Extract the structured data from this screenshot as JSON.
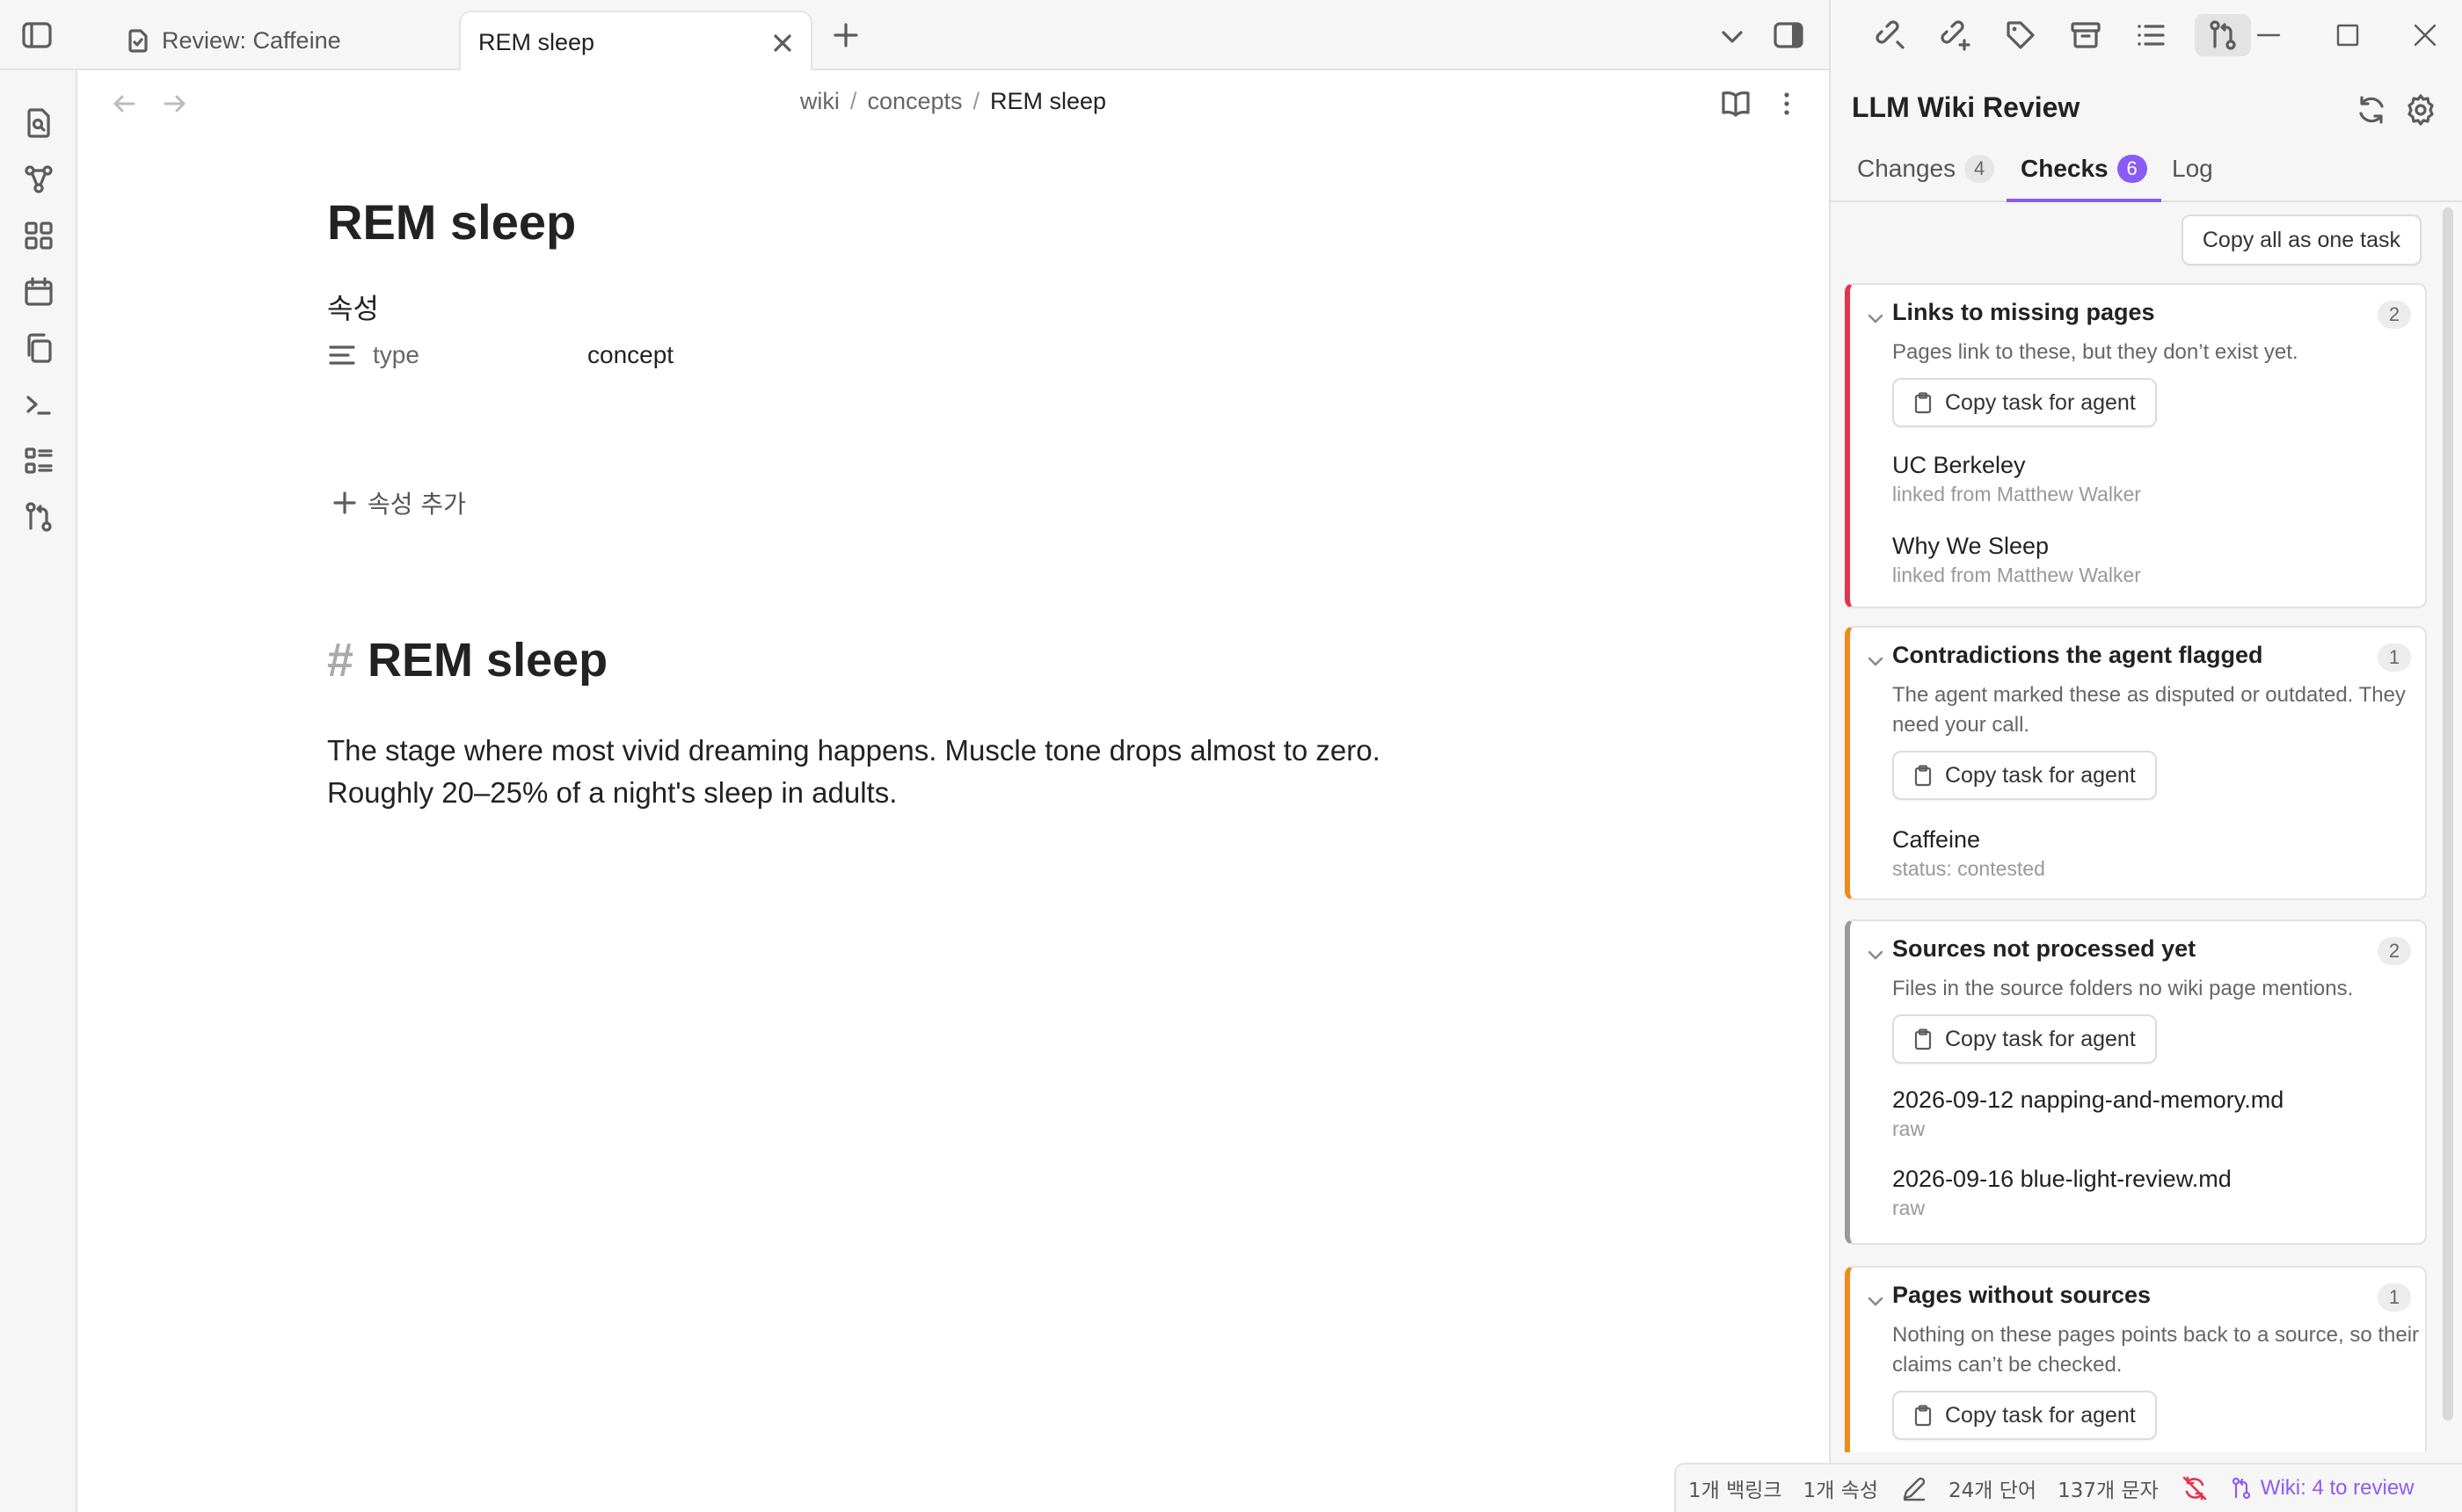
{
  "colors": {
    "accent": "#8a5cf5",
    "missing_pages_border": "#e5334b",
    "contradictions_border": "#f08a1c",
    "sources_border": "#9a9a9a",
    "pages_without_sources_border": "#f08a1c",
    "sync_error": "#e5334b"
  },
  "tabs": [
    {
      "label": "Review: Caffeine",
      "icon": "file-icon",
      "active": false
    },
    {
      "label": "REM sleep",
      "active": true
    }
  ],
  "ribbon": {
    "icons": [
      "search-file-icon",
      "graph-icon",
      "canvas-icon",
      "calendar-icon",
      "copy-icon",
      "terminal-icon",
      "outline-icon",
      "git-compare-icon"
    ]
  },
  "editor": {
    "breadcrumb": [
      "wiki",
      "concepts",
      "REM sleep"
    ],
    "title": "REM sleep",
    "properties_heading": "속성",
    "properties": [
      {
        "key": "type",
        "value": "concept"
      }
    ],
    "add_property_label": "속성 추가",
    "heading_hash": "#",
    "heading": "REM sleep",
    "body": "The stage where most vivid dreaming happens. Muscle tone drops almost to zero. Roughly 20–25% of a night's sleep in adults."
  },
  "panel": {
    "toolbar_icons": [
      "link-off-icon",
      "link-add-icon",
      "tag-icon",
      "archive-icon",
      "list-icon",
      "git-compare-icon"
    ],
    "title": "LLM Wiki Review",
    "tabs": [
      {
        "label": "Changes",
        "count": "4",
        "active": false
      },
      {
        "label": "Checks",
        "count": "6",
        "active": true
      },
      {
        "label": "Log",
        "active": false
      }
    ],
    "copy_all_label": "Copy all as one task",
    "copy_task_label": "Copy task for agent",
    "groups": [
      {
        "title": "Links to missing pages",
        "count": "2",
        "description": "Pages link to these, but they don’t exist yet.",
        "items": [
          {
            "name": "UC Berkeley",
            "sub": "linked from Matthew Walker"
          },
          {
            "name": "Why We Sleep",
            "sub": "linked from Matthew Walker"
          }
        ]
      },
      {
        "title": "Contradictions the agent flagged",
        "count": "1",
        "description": "The agent marked these as disputed or outdated. They need your call.",
        "items": [
          {
            "name": "Caffeine",
            "sub": "status: contested"
          }
        ]
      },
      {
        "title": "Sources not processed yet",
        "count": "2",
        "description": "Files in the source folders no wiki page mentions.",
        "items": [
          {
            "name": "2026-09-12 napping-and-memory.md",
            "sub": "raw"
          },
          {
            "name": "2026-09-16 blue-light-review.md",
            "sub": "raw"
          }
        ]
      },
      {
        "title": "Pages without sources",
        "count": "1",
        "description": "Nothing on these pages points back to a source, so their claims can’t be checked.",
        "items": []
      }
    ]
  },
  "status_bar": {
    "backlinks": "1개 백링크",
    "properties": "1개 속성",
    "words": "24개 단어",
    "characters": "137개 문자",
    "wiki_status": "Wiki: 4 to review"
  }
}
